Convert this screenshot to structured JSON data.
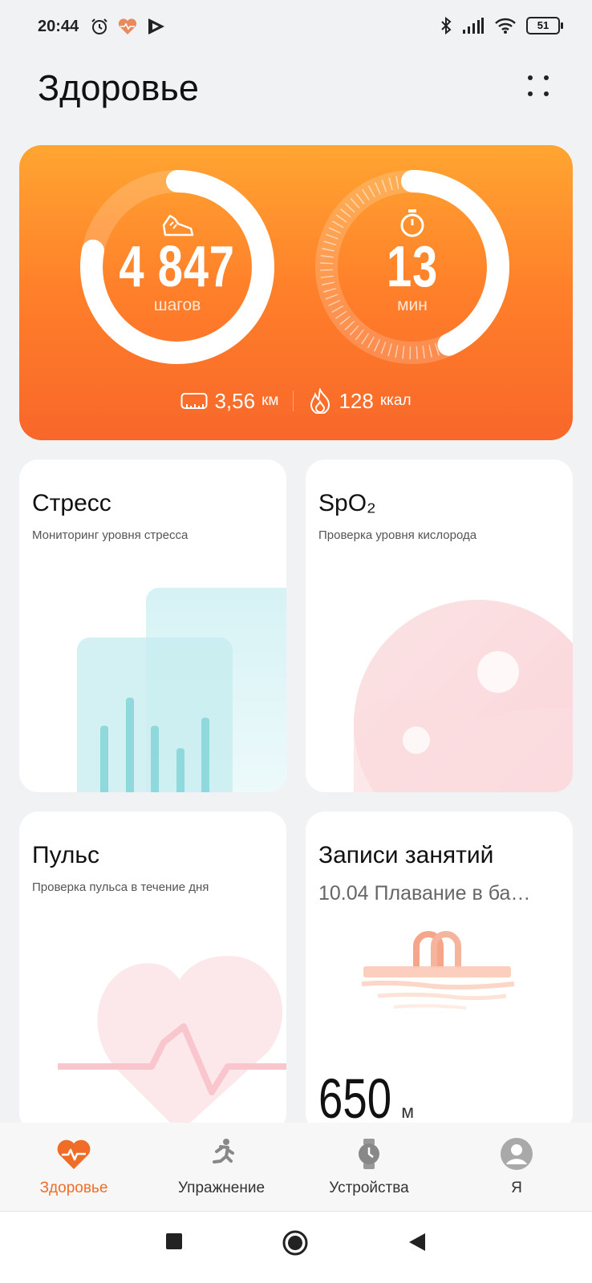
{
  "status_bar": {
    "time": "20:44",
    "battery": "51",
    "icons_left": [
      "alarm-icon",
      "health-heart-icon",
      "play-icon"
    ],
    "icons_right": [
      "bluetooth-icon",
      "signal-icon",
      "wifi-icon",
      "battery-icon"
    ]
  },
  "header": {
    "title": "Здоровье",
    "menu_icon": "more-dots-icon"
  },
  "activity": {
    "steps_value": "4 847",
    "steps_unit": "шагов",
    "steps_progress": 0.78,
    "minutes_value": "13",
    "minutes_unit": "мин",
    "minutes_progress": 0.43,
    "distance_value": "3,56",
    "distance_unit": "км",
    "calories_value": "128",
    "calories_unit": "ккал",
    "colors": {
      "gradient_top": "#ffa531",
      "gradient_bottom": "#f8672a"
    }
  },
  "cards": {
    "stress": {
      "title": "Стресс",
      "subtitle": "Мониторинг уровня стресса"
    },
    "spo2": {
      "title": "SpO₂",
      "subtitle": "Проверка уровня кислорода"
    },
    "pulse": {
      "title": "Пульс",
      "subtitle": "Проверка пульса в течение дня"
    },
    "workouts": {
      "title": "Записи занятий",
      "subtitle": "10.04 Плавание в ба…",
      "distance_value": "650",
      "distance_unit": "м"
    }
  },
  "bottom_nav": {
    "items": [
      {
        "label": "Здоровье",
        "icon": "heart-pulse-icon",
        "active": true
      },
      {
        "label": "Упражнение",
        "icon": "running-icon",
        "active": false
      },
      {
        "label": "Устройства",
        "icon": "watch-icon",
        "active": false
      },
      {
        "label": "Я",
        "icon": "avatar-icon",
        "active": false
      }
    ],
    "accent": "#ef6d27"
  },
  "system_nav": {
    "buttons": [
      "recents-button",
      "home-button",
      "back-button"
    ]
  }
}
